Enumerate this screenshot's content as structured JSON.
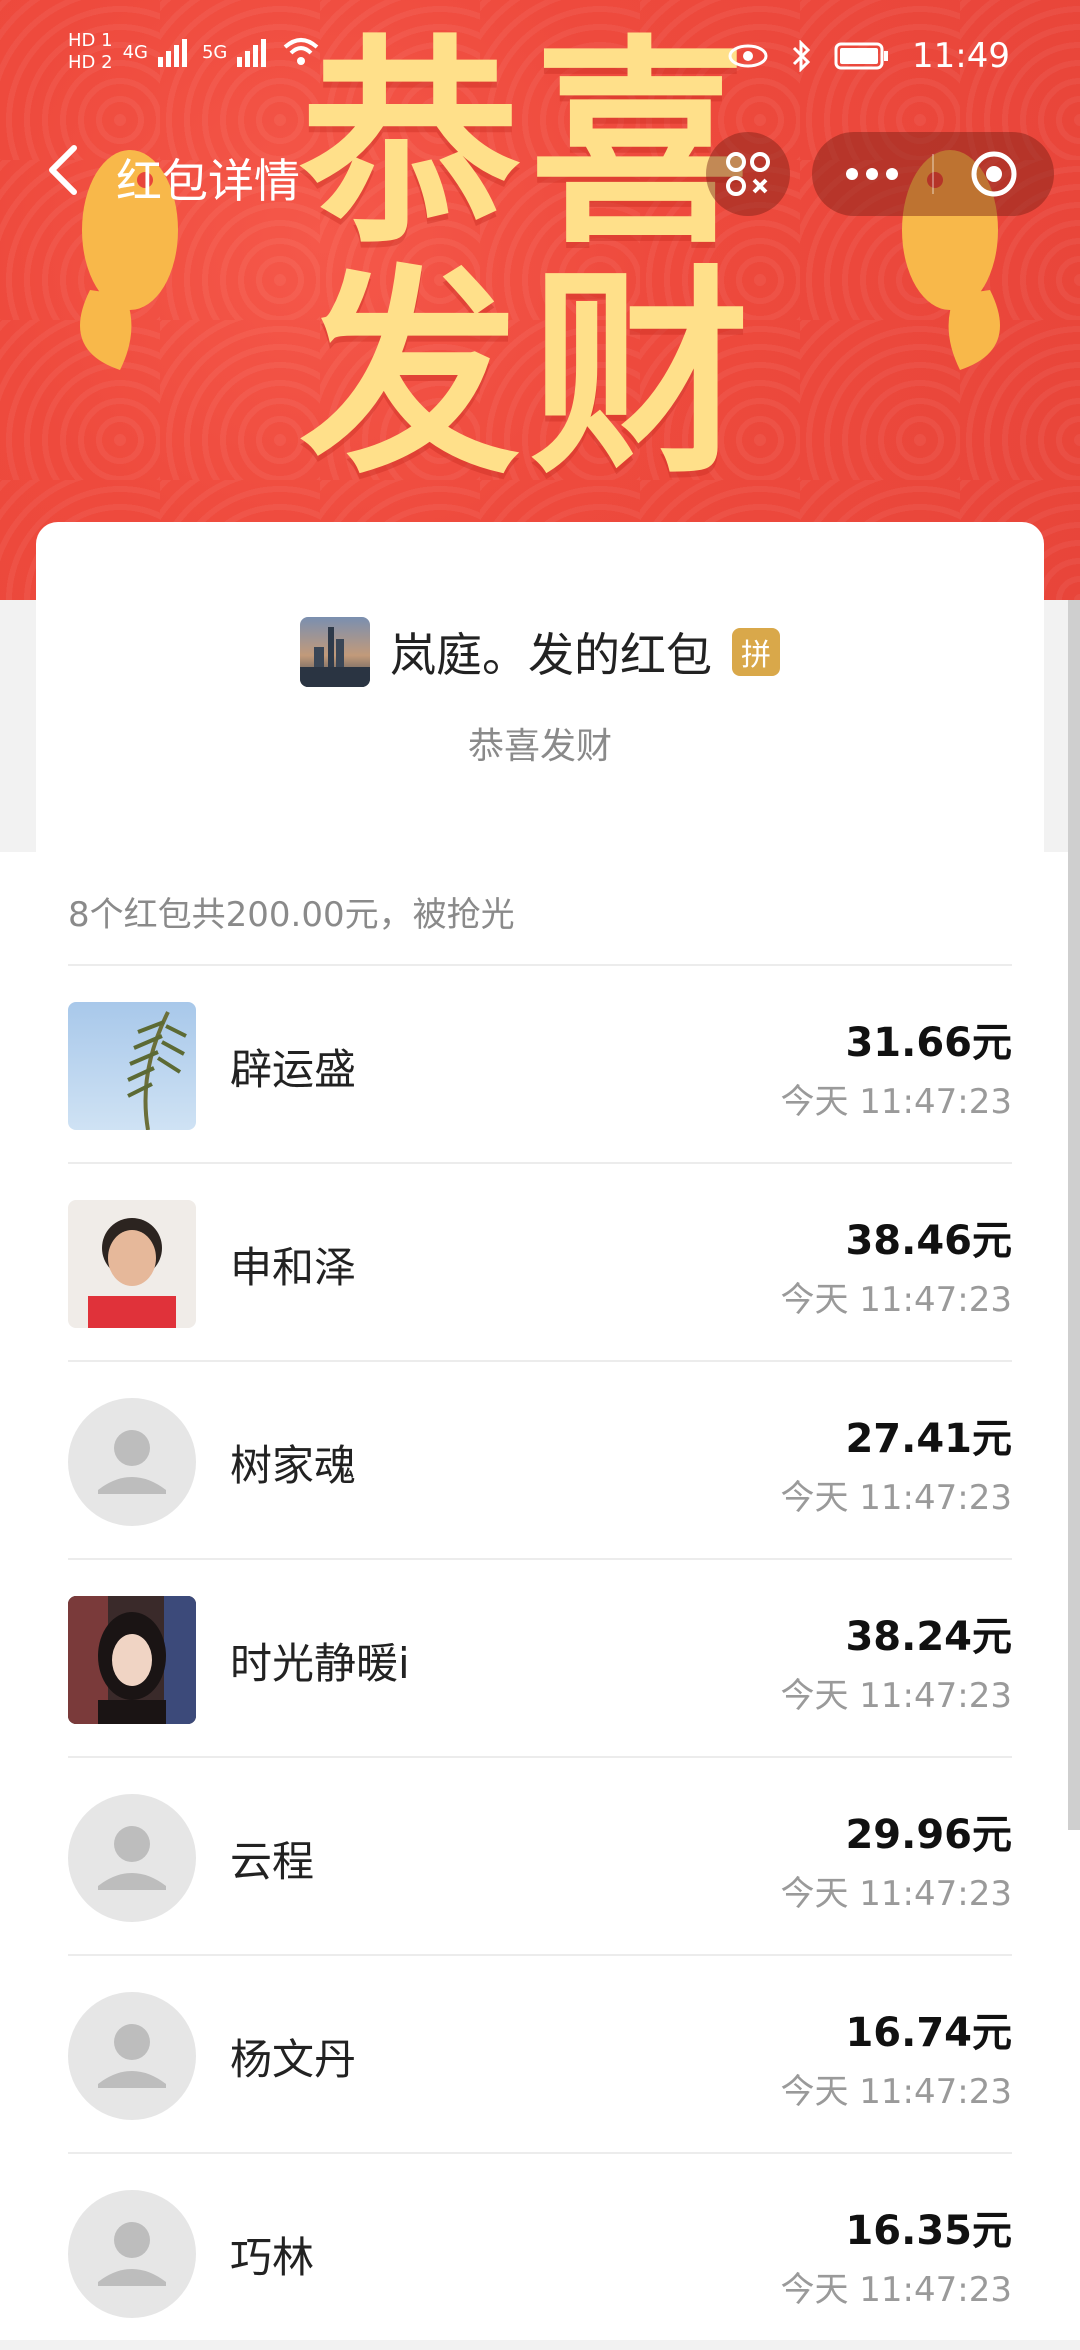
{
  "status_bar": {
    "left": [
      "HD 1",
      "HD 2",
      "4G",
      "5G"
    ],
    "time": "11:49"
  },
  "banner": {
    "line1": "恭喜",
    "line2": "发财"
  },
  "nav": {
    "title": "红包详情"
  },
  "packet": {
    "sender": "岚庭。发的红包",
    "badge": "拼",
    "wish": "恭喜发财",
    "summary": "8个红包共200.00元，被抢光"
  },
  "recipients": [
    {
      "name": "辟运盛",
      "amount": "31.66元",
      "time": "今天 11:47:23",
      "avatar": "palm"
    },
    {
      "name": "申和泽",
      "amount": "38.46元",
      "time": "今天 11:47:23",
      "avatar": "photo-woman"
    },
    {
      "name": "树家魂",
      "amount": "27.41元",
      "time": "今天 11:47:23",
      "avatar": "placeholder"
    },
    {
      "name": "时光静暖i",
      "amount": "38.24元",
      "time": "今天 11:47:23",
      "avatar": "photo-girl"
    },
    {
      "name": "云程",
      "amount": "29.96元",
      "time": "今天 11:47:23",
      "avatar": "placeholder"
    },
    {
      "name": "杨文丹",
      "amount": "16.74元",
      "time": "今天 11:47:23",
      "avatar": "placeholder"
    },
    {
      "name": "巧林",
      "amount": "16.35元",
      "time": "今天 11:47:23",
      "avatar": "placeholder"
    }
  ],
  "colors": {
    "banner_red": "#ee4a3d",
    "banner_text": "#ffe08a",
    "badge": "#d9a84a"
  }
}
